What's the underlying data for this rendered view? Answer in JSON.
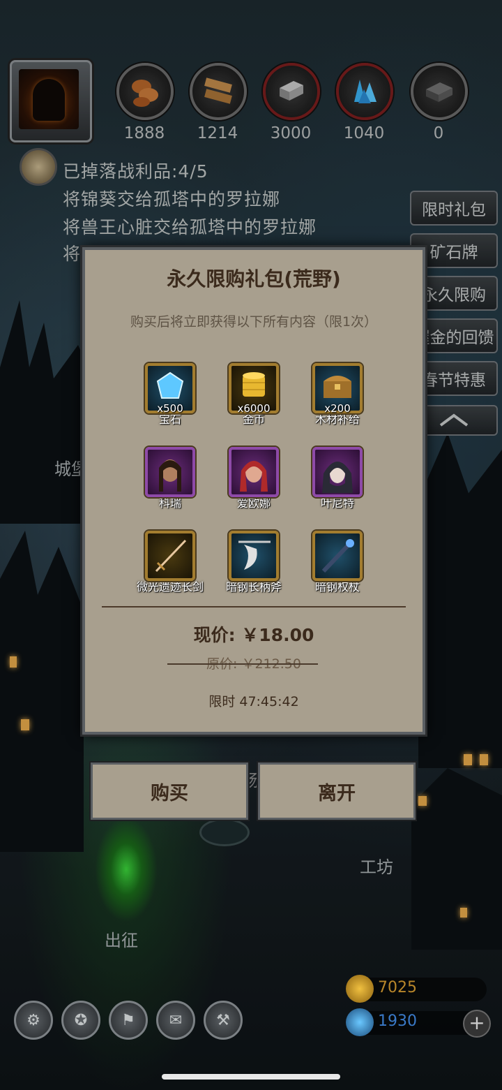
{
  "resources": [
    {
      "name": "meat",
      "value": "1888"
    },
    {
      "name": "wood",
      "value": "1214"
    },
    {
      "name": "iron",
      "value": "3000"
    },
    {
      "name": "crystal",
      "value": "1040"
    },
    {
      "name": "steel",
      "value": "0"
    }
  ],
  "quests": [
    "已掉落战利品:4/5",
    "将锦葵交给孤塔中的罗拉娜",
    "将兽王心脏交给孤塔中的罗拉娜",
    "将"
  ],
  "side_menu": [
    "限时礼包",
    "矿石牌",
    "永久限购",
    "握金的回馈",
    "春节特惠"
  ],
  "places": {
    "castle": "城堡",
    "workshop": "工坊",
    "expedition": "出征",
    "field": "场"
  },
  "dialog": {
    "title": "永久限购礼包(荒野)",
    "subtitle": "购买后将立即获得以下所有内容（限1次）",
    "items": [
      {
        "name": "宝石",
        "qty": "x500",
        "icon": "gem-icon"
      },
      {
        "name": "金币",
        "qty": "x6000",
        "icon": "gold-coins-icon"
      },
      {
        "name": "木材补给",
        "qty": "x200",
        "icon": "chest-icon"
      },
      {
        "name": "科瑞",
        "qty": "",
        "icon": "hero-portrait"
      },
      {
        "name": "爱欧娜",
        "qty": "",
        "icon": "hero-portrait"
      },
      {
        "name": "叶尼特",
        "qty": "",
        "icon": "hero-portrait"
      },
      {
        "name": "微光遗迹长剑",
        "qty": "",
        "icon": "sword-icon"
      },
      {
        "name": "暗钢长柄斧",
        "qty": "",
        "icon": "axe-icon"
      },
      {
        "name": "暗钢权杖",
        "qty": "",
        "icon": "scepter-icon"
      }
    ],
    "price": "现价: ￥18.00",
    "original_price": "原价: ￥212.50",
    "timer": "限时 47:45:42"
  },
  "buttons": {
    "buy": "购买",
    "leave": "离开"
  },
  "currencies": {
    "gold": "7025",
    "gems": "1930",
    "add": "+"
  },
  "colors": {
    "gold_text": "#b8862a",
    "gem_text": "#3a7ac8",
    "panel": "#a89f8e"
  }
}
